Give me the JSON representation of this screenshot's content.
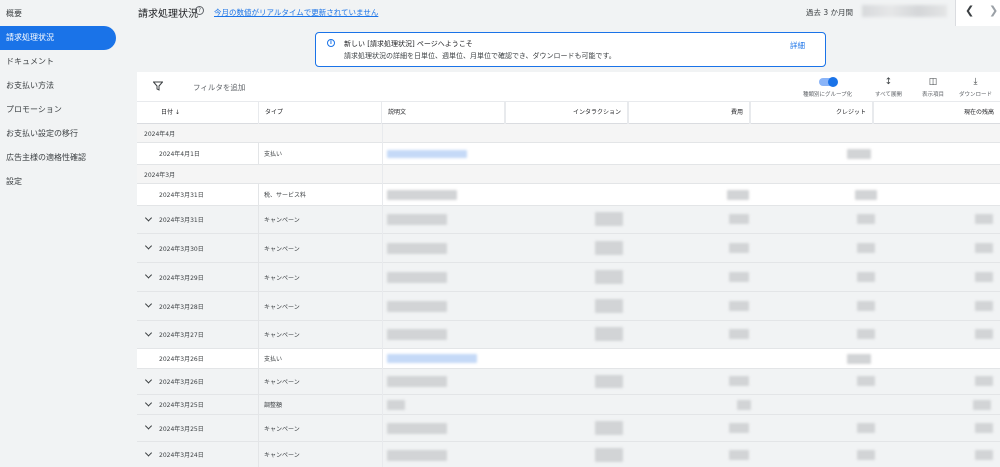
{
  "sidebar": {
    "items": [
      {
        "label": "概要",
        "active": false
      },
      {
        "label": "請求処理状況",
        "active": true
      },
      {
        "label": "ドキュメント",
        "active": false
      },
      {
        "label": "お支払い方法",
        "active": false
      },
      {
        "label": "プロモーション",
        "active": false
      },
      {
        "label": "お支払い設定の移行",
        "active": false
      },
      {
        "label": "広告主様の適格性確認",
        "active": false
      },
      {
        "label": "設定",
        "active": false
      }
    ]
  },
  "header": {
    "title": "請求処理状況",
    "realtime_link": "今月の数値がリアルタイムで更新されていません",
    "period": "過去 3 か月間"
  },
  "notice": {
    "title": "新しい [請求処理状況] ページへようこそ",
    "body": "請求処理状況の詳細を日単位、週単位、月単位で確認でき、ダウンロードも可能です。",
    "link": "詳細"
  },
  "toolbar": {
    "filter_label": "フィルタを追加",
    "group_by_type": "種類別にグループ化",
    "expand_all": "すべて展開",
    "columns": "表示項目",
    "download": "ダウンロード"
  },
  "table": {
    "headers": {
      "date": "日付",
      "type": "タイプ",
      "description": "説明文",
      "interactions": "インタラクション",
      "cost": "費用",
      "credit": "クレジット",
      "balance": "現在の残高"
    },
    "months": [
      "2024年4月",
      "2024年3月"
    ],
    "rows": [
      {
        "date": "2024年4月1日",
        "type": "支払い"
      },
      {
        "date": "2024年3月31日",
        "type": "税、サービス料"
      },
      {
        "date": "2024年3月31日",
        "type": "キャンペーン"
      },
      {
        "date": "2024年3月30日",
        "type": "キャンペーン"
      },
      {
        "date": "2024年3月29日",
        "type": "キャンペーン"
      },
      {
        "date": "2024年3月28日",
        "type": "キャンペーン"
      },
      {
        "date": "2024年3月27日",
        "type": "キャンペーン"
      },
      {
        "date": "2024年3月26日",
        "type": "支払い"
      },
      {
        "date": "2024年3月26日",
        "type": "キャンペーン"
      },
      {
        "date": "2024年3月25日",
        "type": "調整額"
      },
      {
        "date": "2024年3月25日",
        "type": "キャンペーン"
      },
      {
        "date": "2024年3月24日",
        "type": "キャンペーン"
      }
    ]
  },
  "colors": {
    "accent": "#1a73e8",
    "background": "#f1f3f4"
  }
}
